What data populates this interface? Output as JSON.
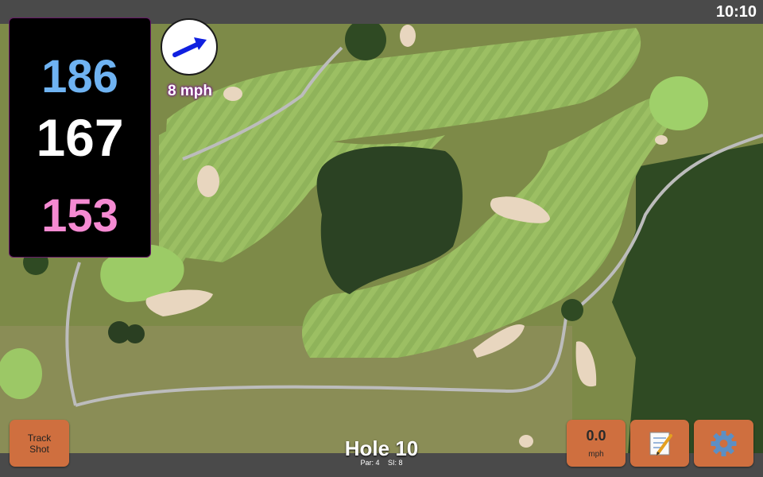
{
  "status": {
    "time": "10:10"
  },
  "distances": {
    "back": "186",
    "middle": "167",
    "front": "153"
  },
  "wind": {
    "speed_label": "8 mph",
    "icon": "wind-arrow-icon",
    "arrow_color": "#1020e0"
  },
  "hole": {
    "title": "Hole 10",
    "par_label": "Par: 4",
    "si_label": "SI: 8"
  },
  "buttons": {
    "track_line1": "Track",
    "track_line2": "Shot",
    "speed_value": "0.0",
    "speed_unit": "mph",
    "notes_icon": "notepad-icon",
    "settings_icon": "gear-icon"
  },
  "colors": {
    "back": "#6fb3f2",
    "middle": "#ffffff",
    "front": "#f58ad2",
    "button": "#cf6f3f"
  }
}
